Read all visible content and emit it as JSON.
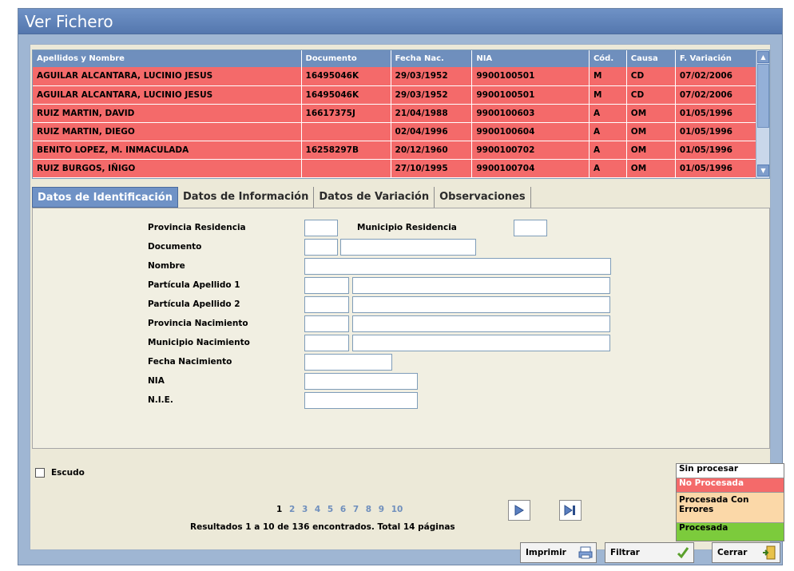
{
  "window": {
    "title": "Ver Fichero"
  },
  "grid": {
    "columns": [
      "Apellidos y Nombre",
      "Documento",
      "Fecha Nac.",
      "NIA",
      "Cód.",
      "Causa",
      "F. Variación"
    ],
    "rows": [
      [
        "AGUILAR ALCANTARA, LUCINIO JESUS",
        "16495046K",
        "29/03/1952",
        "9900100501",
        "M",
        "CD",
        "07/02/2006"
      ],
      [
        "AGUILAR ALCANTARA, LUCINIO JESUS",
        "16495046K",
        "29/03/1952",
        "9900100501",
        "M",
        "CD",
        "07/02/2006"
      ],
      [
        "RUIZ MARTIN, DAVID",
        "16617375J",
        "21/04/1988",
        "9900100603",
        "A",
        "OM",
        "01/05/1996"
      ],
      [
        "RUIZ MARTIN, DIEGO",
        "",
        "02/04/1996",
        "9900100604",
        "A",
        "OM",
        "01/05/1996"
      ],
      [
        "BENITO LOPEZ, M. INMACULADA",
        "16258297B",
        "20/12/1960",
        "9900100702",
        "A",
        "OM",
        "01/05/1996"
      ],
      [
        "RUIZ BURGOS, IÑIGO",
        "",
        "27/10/1995",
        "9900100704",
        "A",
        "OM",
        "01/05/1996"
      ]
    ],
    "row_status": "No Procesada"
  },
  "tabs": [
    {
      "label": "Datos de Identificación",
      "active": true
    },
    {
      "label": "Datos de Información",
      "active": false
    },
    {
      "label": "Datos de Variación",
      "active": false
    },
    {
      "label": "Observaciones",
      "active": false
    }
  ],
  "form": {
    "provincia_residencia": "Provincia Residencia",
    "municipio_residencia": "Municipio Residencia",
    "documento": "Documento",
    "nombre": "Nombre",
    "particula_apellido_1": "Partícula Apellido 1",
    "particula_apellido_2": "Partícula Apellido 2",
    "provincia_nacimiento": "Provincia Nacimiento",
    "municipio_nacimiento": "Municipio Nacimiento",
    "fecha_nacimiento": "Fecha Nacimiento",
    "nia": "NIA",
    "nie": "N.I.E."
  },
  "escudo": {
    "label": "Escudo",
    "checked": false
  },
  "pagination": {
    "current": "1",
    "pages": [
      "2",
      "3",
      "4",
      "5",
      "6",
      "7",
      "8",
      "9",
      "10"
    ],
    "results_text": "Resultados 1 a 10 de 136 encontrados. Total 14 páginas",
    "next_icon": "play-next-icon",
    "last_icon": "skip-last-icon"
  },
  "legend": {
    "items": [
      {
        "label": "Sin procesar",
        "color": "#ffffff"
      },
      {
        "label": "No Procesada",
        "color": "#f46a6a"
      },
      {
        "label": "Procesada Con Errores",
        "color": "#fbd8a8"
      },
      {
        "label": "Procesada",
        "color": "#7ccb3c"
      }
    ]
  },
  "buttons": {
    "print": "Imprimir",
    "filter": "Filtrar",
    "close": "Cerrar"
  }
}
